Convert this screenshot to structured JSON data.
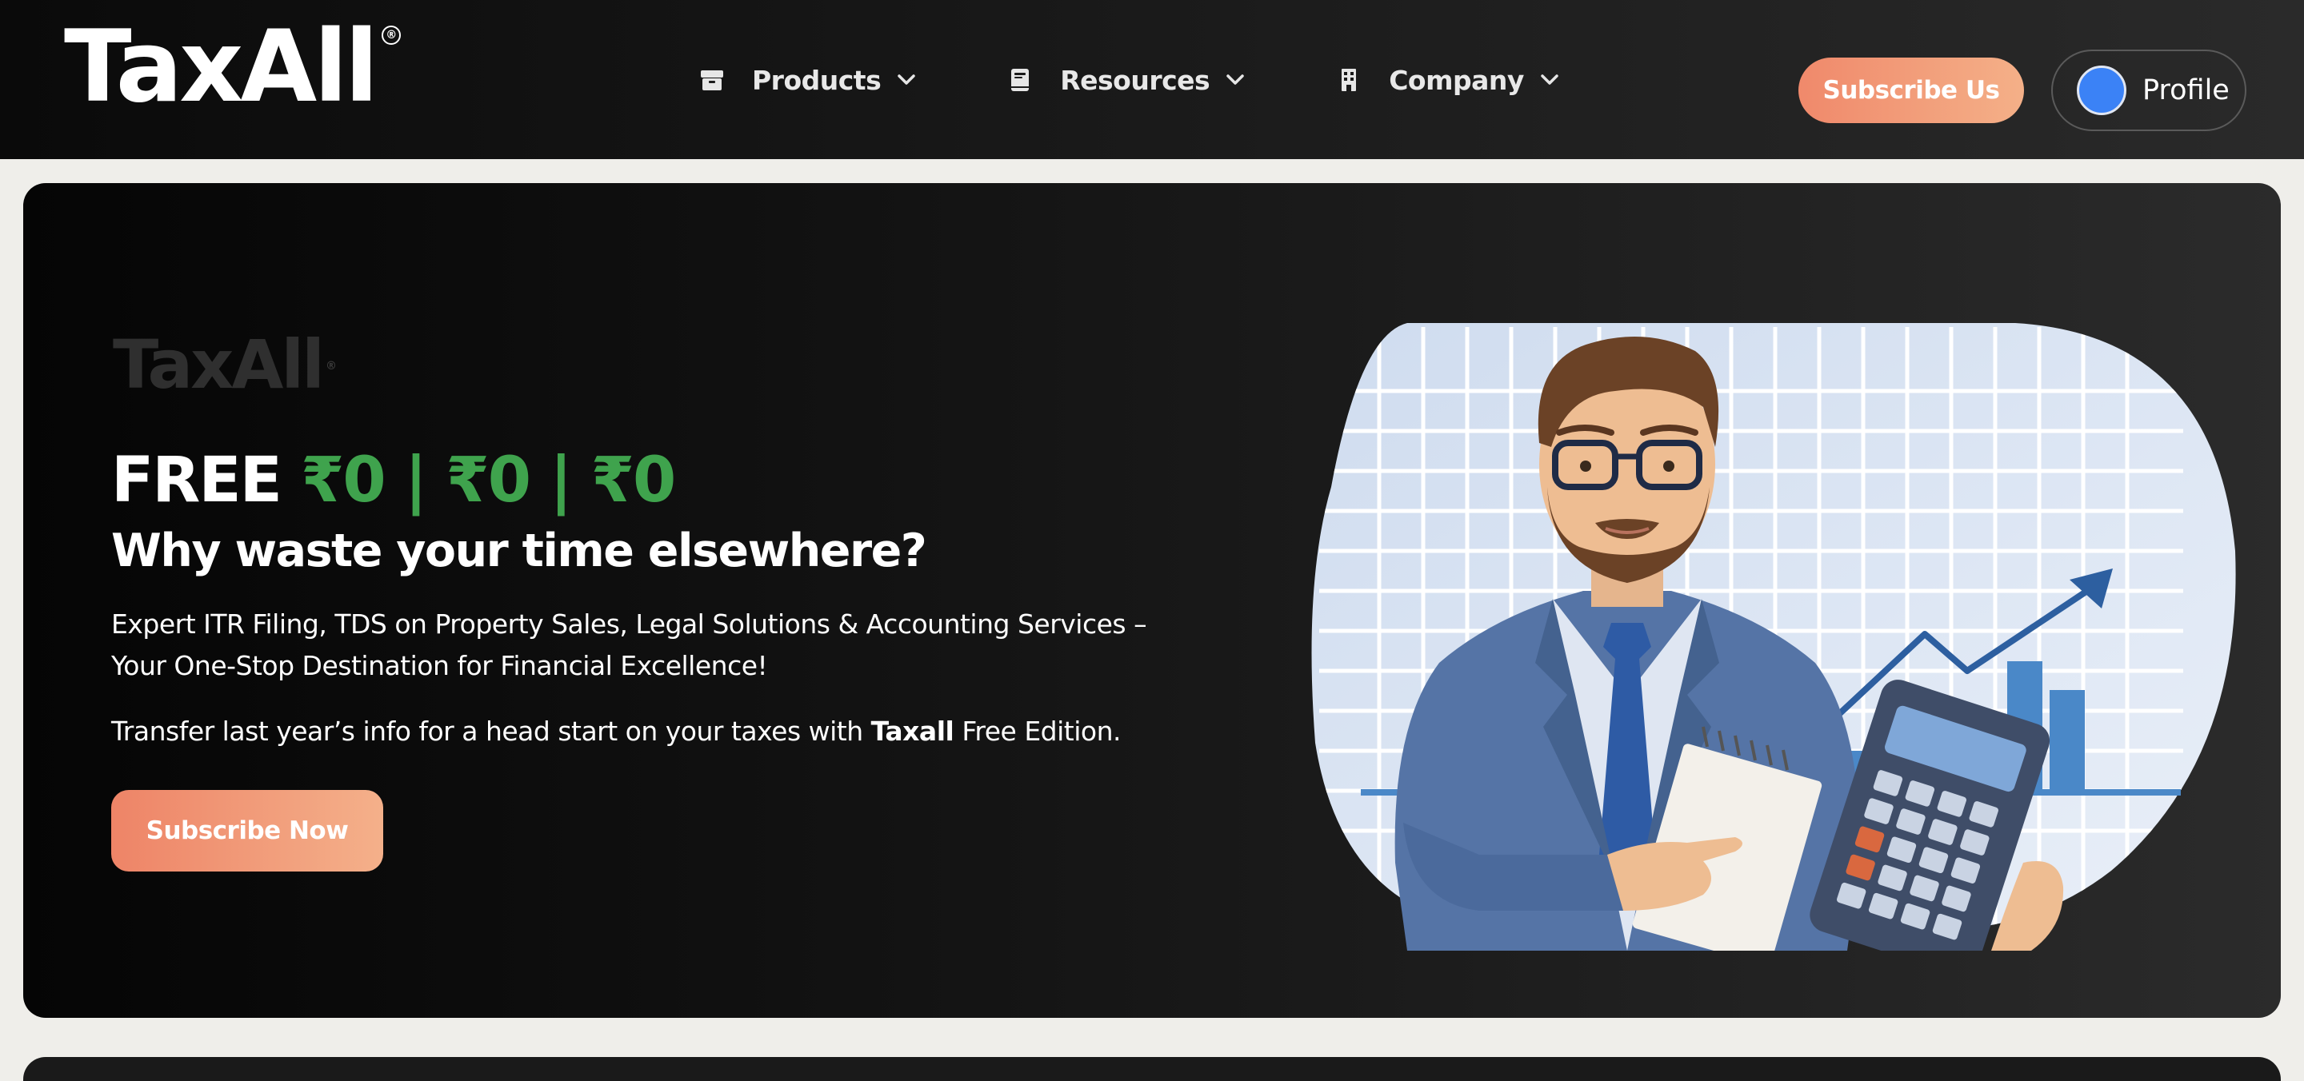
{
  "brand": {
    "logo_text": "TaxAll",
    "registered_mark": "®"
  },
  "nav": {
    "items": [
      {
        "label": "Products",
        "icon": "box-icon"
      },
      {
        "label": "Resources",
        "icon": "book-icon"
      },
      {
        "label": "Company",
        "icon": "building-icon"
      }
    ],
    "subscribe_label": "Subscribe Us",
    "profile_label": "Profile"
  },
  "hero": {
    "watermark_text": "TaxAll",
    "free_word": "FREE",
    "free_price": "₹0 | ₹0 | ₹0",
    "headline": "Why waste your time elsewhere?",
    "description": "Expert ITR Filing, TDS on Property Sales, Legal Solutions & Accounting Services – Your One-Stop Destination for Financial Excellence!",
    "transfer_prefix": "Transfer last year’s info for a head start on your taxes with ",
    "transfer_brand": "Taxall",
    "transfer_suffix": " Free Edition.",
    "cta_label": "Subscribe Now"
  },
  "colors": {
    "accent_orange": "#f0896b",
    "accent_green": "#3fa34d",
    "avatar_blue": "#3b82f6"
  }
}
